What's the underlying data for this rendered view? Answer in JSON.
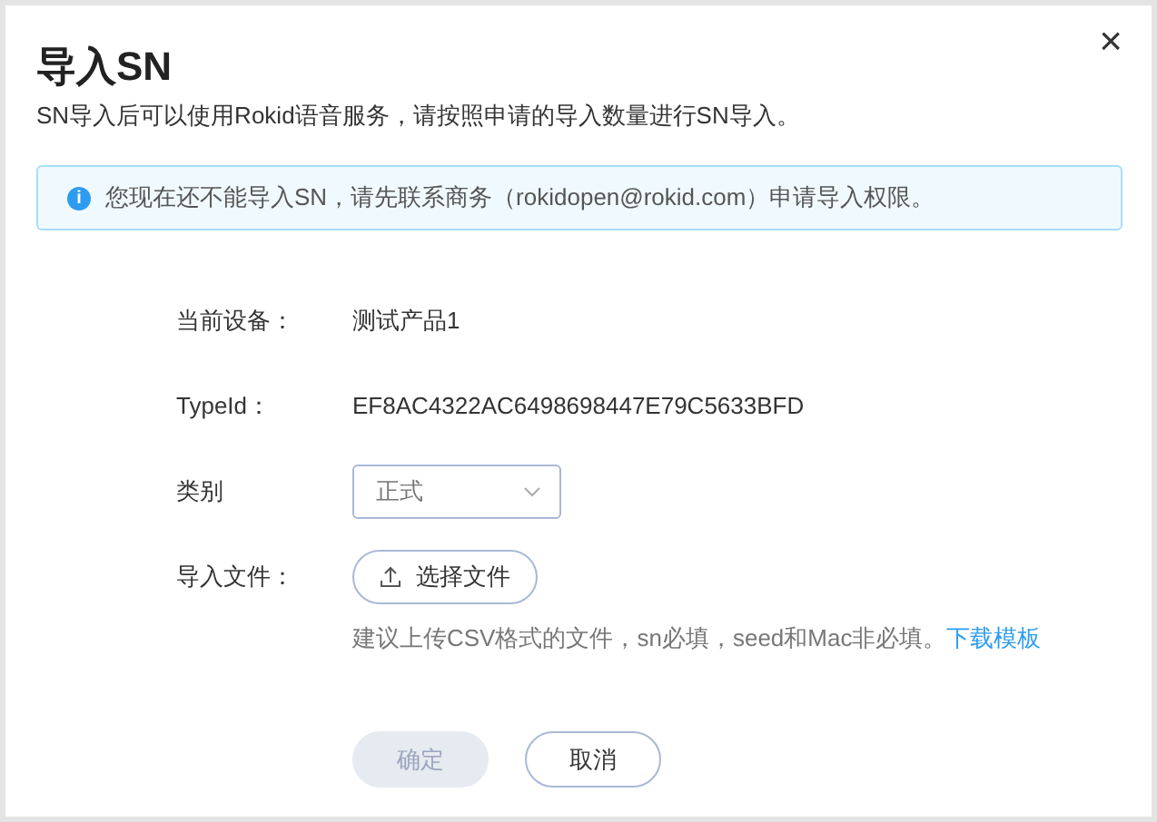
{
  "dialog": {
    "title": "导入SN",
    "close": "×",
    "subtitle": "SN导入后可以使用Rokid语音服务，请按照申请的导入数量进行SN导入。"
  },
  "alert": {
    "icon": "i",
    "text": "您现在还不能导入SN，请先联系商务（rokidopen@rokid.com）申请导入权限。"
  },
  "form": [
    {
      "kind": "text",
      "label": "当前设备：",
      "value": "测试产品1"
    },
    {
      "kind": "text",
      "label": "TypeId：",
      "value": "EF8AC4322AC6498698447E79C5633BFD"
    },
    {
      "kind": "select",
      "label": "类别",
      "value": "正式"
    },
    {
      "kind": "upload",
      "label": "导入文件：",
      "button": "选择文件",
      "hint": "建议上传CSV格式的文件，sn必填，seed和Mac非必填。",
      "link": "下载模板"
    }
  ],
  "buttons": [
    {
      "label": "确定",
      "disabled": true
    },
    {
      "label": "取消",
      "disabled": false
    }
  ]
}
